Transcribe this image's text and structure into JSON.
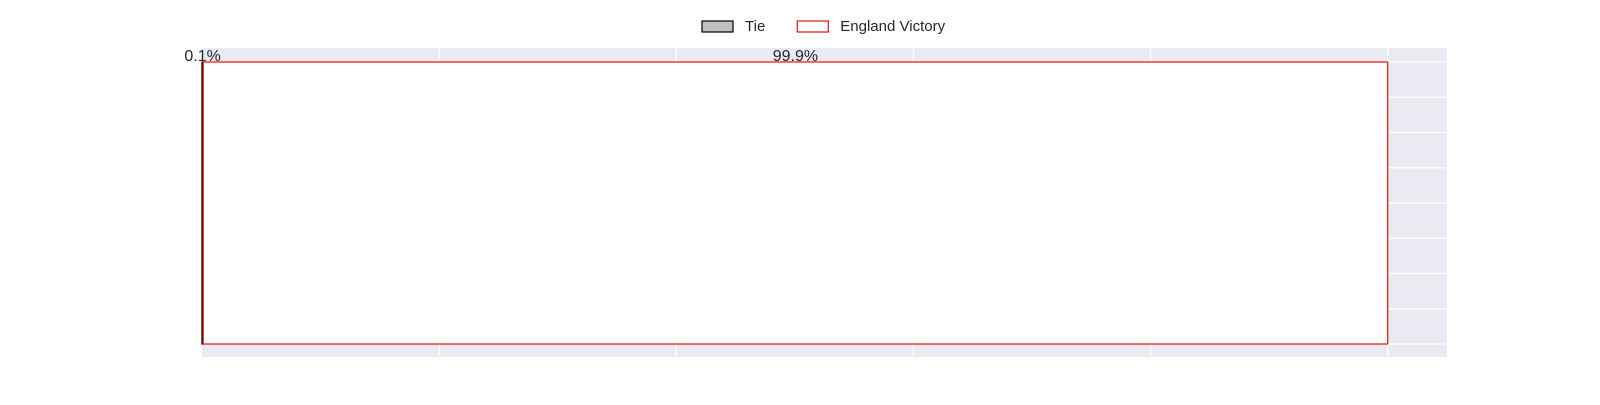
{
  "chart_data": {
    "type": "bar",
    "orientation": "horizontal",
    "stacked": true,
    "xlim": [
      0,
      105
    ],
    "grid": true,
    "legend_placement": "top-center",
    "series": [
      {
        "name": "Tie",
        "values": [
          0.1
        ],
        "label": "0.1%",
        "fill": "#bfbfbf",
        "edge": "#000000"
      },
      {
        "name": "England Victory",
        "values": [
          99.9
        ],
        "label": "99.9%",
        "fill": "#ffffff",
        "edge": "#e3120b"
      }
    ]
  },
  "colors": {
    "plot_background": "#eaeaf2",
    "grid": "#ffffff",
    "text": "#262626"
  }
}
